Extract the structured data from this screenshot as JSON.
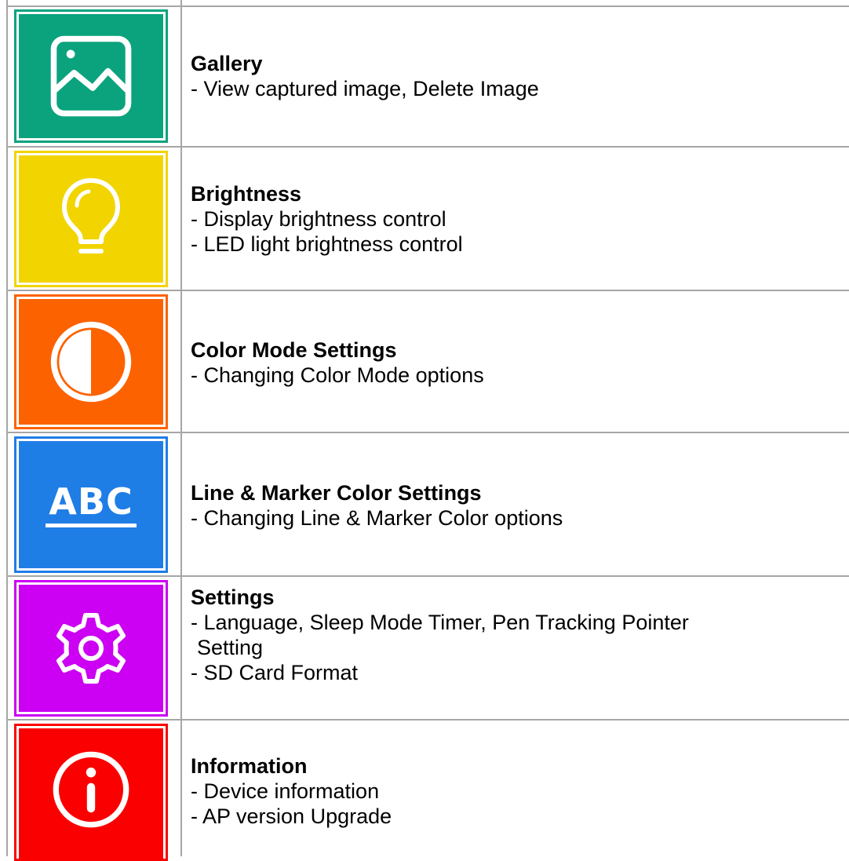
{
  "colors": {
    "gallery": "#0aa37e",
    "brightness": "#f1d400",
    "color_mode": "#fd6200",
    "line_marker": "#1f7de6",
    "settings": "#cc00f3",
    "information": "#fb0000",
    "grid": "#a6a6a6"
  },
  "rows": [
    {
      "icon": "image-icon",
      "title": "Gallery",
      "lines": [
        "- View captured image, Delete Image"
      ]
    },
    {
      "icon": "lightbulb-icon",
      "title": "Brightness",
      "lines": [
        "- Display brightness control",
        "- LED light brightness control"
      ]
    },
    {
      "icon": "contrast-icon",
      "title": "Color Mode Settings",
      "lines": [
        "- Changing Color Mode options"
      ]
    },
    {
      "icon": "abc-text-icon",
      "icon_text": "ABC",
      "title": "Line & Marker Color Settings",
      "lines": [
        "- Changing Line & Marker Color options"
      ]
    },
    {
      "icon": "gear-icon",
      "title": "Settings",
      "lines": [
        "- Language, Sleep Mode Timer, Pen Tracking Pointer",
        "Setting",
        "- SD Card Format"
      ]
    },
    {
      "icon": "info-icon",
      "title": "Information",
      "lines": [
        "- Device information",
        "- AP version Upgrade"
      ]
    }
  ]
}
